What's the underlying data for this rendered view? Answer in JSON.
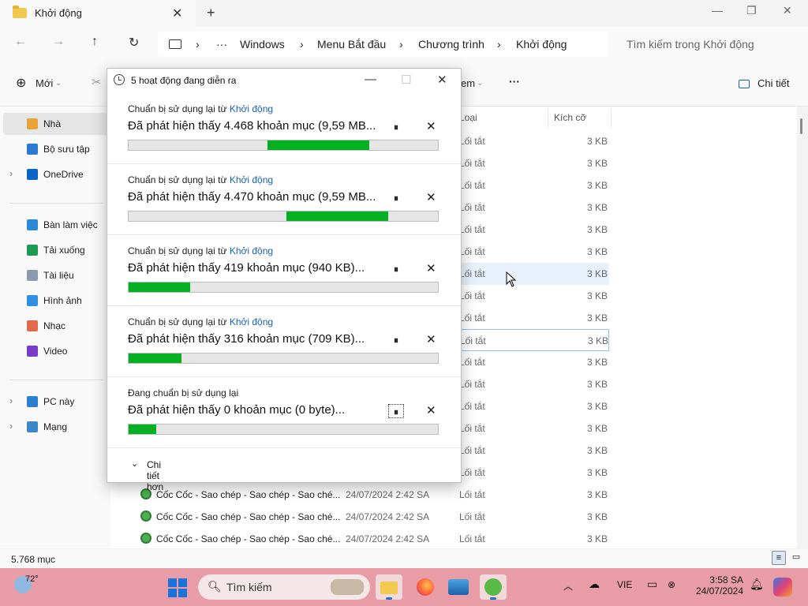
{
  "window": {
    "tab_title": "Khởi động",
    "close_tab": "✕",
    "new_tab": "+",
    "minimize": "—",
    "maximize": "❐",
    "close": "✕"
  },
  "address": {
    "back": "←",
    "forward": "→",
    "up": "↑",
    "refresh": "↻",
    "more": "···",
    "breadcrumbs": [
      "Windows",
      "Menu Bắt đầu",
      "Chương trình",
      "Khởi động"
    ],
    "search_placeholder": "Tìm kiếm trong Khởi động"
  },
  "toolbar": {
    "new_label": "Mới",
    "view_label": "em",
    "more": "···",
    "details_label": "Chi tiết"
  },
  "sidebar": {
    "items": [
      {
        "label": "Nhà",
        "icon": "home-icon",
        "color": "#e8a23a",
        "chev": ""
      },
      {
        "label": "Bộ sưu tập",
        "icon": "gallery-icon",
        "color": "#2b79d0",
        "chev": ""
      },
      {
        "label": "OneDrive",
        "icon": "cloud-icon",
        "color": "#0a64c8",
        "chev": "›"
      },
      {
        "label": "Bàn làm việc",
        "icon": "desktop-icon",
        "color": "#2a8ad8",
        "chev": ""
      },
      {
        "label": "Tải xuống",
        "icon": "download-icon",
        "color": "#1e9a52",
        "chev": ""
      },
      {
        "label": "Tài liệu",
        "icon": "document-icon",
        "color": "#8a9bb0",
        "chev": ""
      },
      {
        "label": "Hình ảnh",
        "icon": "pictures-icon",
        "color": "#2f8fe0",
        "chev": ""
      },
      {
        "label": "Nhạc",
        "icon": "music-icon",
        "color": "#e06a4a",
        "chev": ""
      },
      {
        "label": "Video",
        "icon": "video-icon",
        "color": "#7a3cc8",
        "chev": ""
      },
      {
        "label": "PC này",
        "icon": "pc-icon",
        "color": "#2a7fd0",
        "chev": "›"
      },
      {
        "label": "Mạng",
        "icon": "network-icon",
        "color": "#3a88c8",
        "chev": "›"
      }
    ]
  },
  "filelist": {
    "columns": {
      "type": "Loại",
      "size": "Kích cỡ"
    },
    "row_type": "Lối tắt",
    "row_size": "3 KB",
    "visible_named_rows": [
      {
        "name": "Cốc Cốc - Sao chép - Sao chép - Sao ché...",
        "date": "24/07/2024 2:42 SA"
      },
      {
        "name": "Cốc Cốc - Sao chép - Sao chép - Sao ché...",
        "date": "24/07/2024 2:42 SA"
      },
      {
        "name": "Cốc Cốc - Sao chép - Sao chép - Sao ché...",
        "date": "24/07/2024 2:42 SA"
      }
    ],
    "item_count": "5.768 mục"
  },
  "dialog": {
    "title": "5 hoạt động đang diễn ra",
    "min": "—",
    "max": "☐",
    "close": "✕",
    "cap_prefix": "Chuẩn bị sử dụng lại từ ",
    "cap_link": "Khởi động",
    "pause": "⏸",
    "cancel": "✕",
    "operations": [
      {
        "caption": "Chuẩn bị sử dụng lại từ",
        "link": "Khởi động",
        "message": "Đã phát hiện thấy 4.468 khoản mục (9,59 MB...",
        "progress_start": 0.45,
        "progress_end": 0.78
      },
      {
        "caption": "Chuẩn bị sử dụng lại từ",
        "link": "Khởi động",
        "message": "Đã phát hiện thấy 4.470 khoản mục (9,59 MB...",
        "progress_start": 0.51,
        "progress_end": 0.84
      },
      {
        "caption": "Chuẩn bị sử dụng lại từ",
        "link": "Khởi động",
        "message": "Đã phát hiện thấy 419 khoản mục (940 KB)...",
        "progress_start": 0,
        "progress_end": 0.2
      },
      {
        "caption": "Chuẩn bị sử dụng lại từ",
        "link": "Khởi động",
        "message": "Đã phát hiện thấy 316 khoản mục (709 KB)...",
        "progress_start": 0,
        "progress_end": 0.17
      },
      {
        "caption": "Đang chuẩn bị sử dụng lại",
        "link": "",
        "message": "Đã phát hiện thấy 0 khoản mục (0 byte)...",
        "progress_start": 0,
        "progress_end": 0.09
      }
    ],
    "more_details": "Chi tiết hơn"
  },
  "taskbar": {
    "temperature": "72°",
    "search": "Tìm kiếm",
    "language": "VIE",
    "time": "3:58 SA",
    "date": "24/07/2024"
  }
}
